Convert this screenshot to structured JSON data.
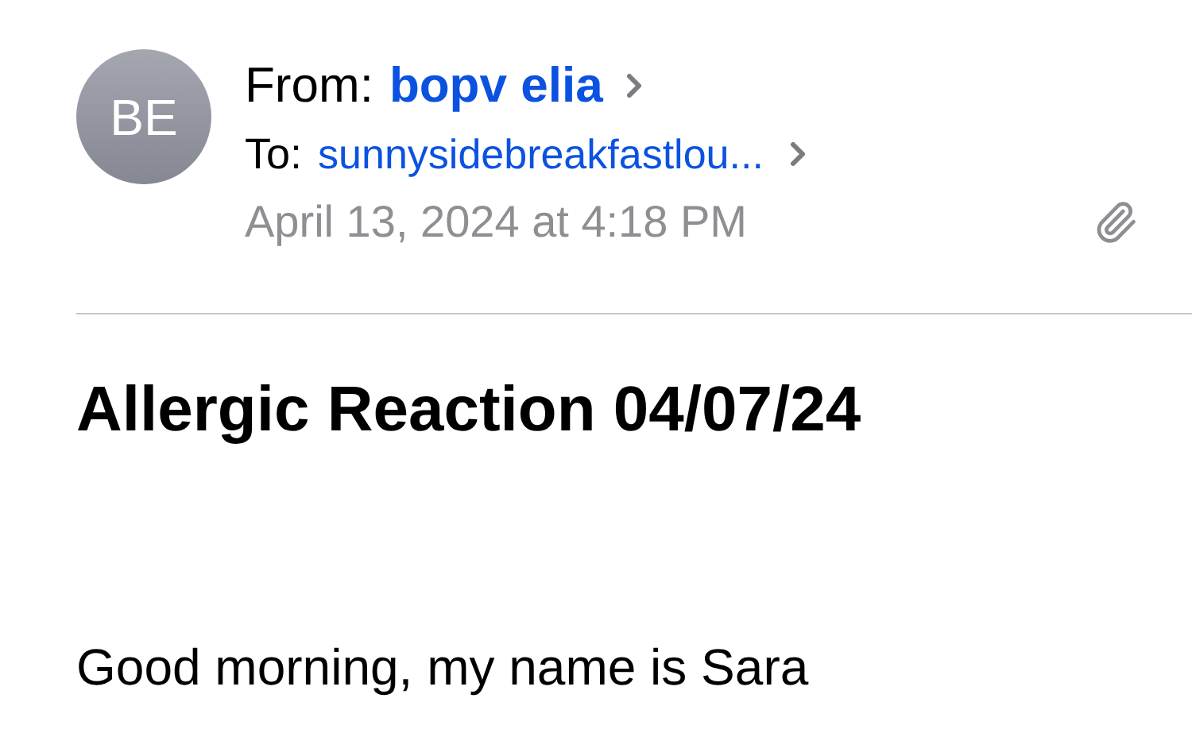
{
  "header": {
    "avatar": "BE",
    "from_label": "From:",
    "from": "bopv elia",
    "to_label": "To:",
    "to": "sunnysidebreakfastlou...",
    "date": "April 13, 2024 at 4:18 PM",
    "has_attachment": true
  },
  "subject": "Allergic Reaction 04/07/24",
  "body": "Good morning, my name is Sara"
}
